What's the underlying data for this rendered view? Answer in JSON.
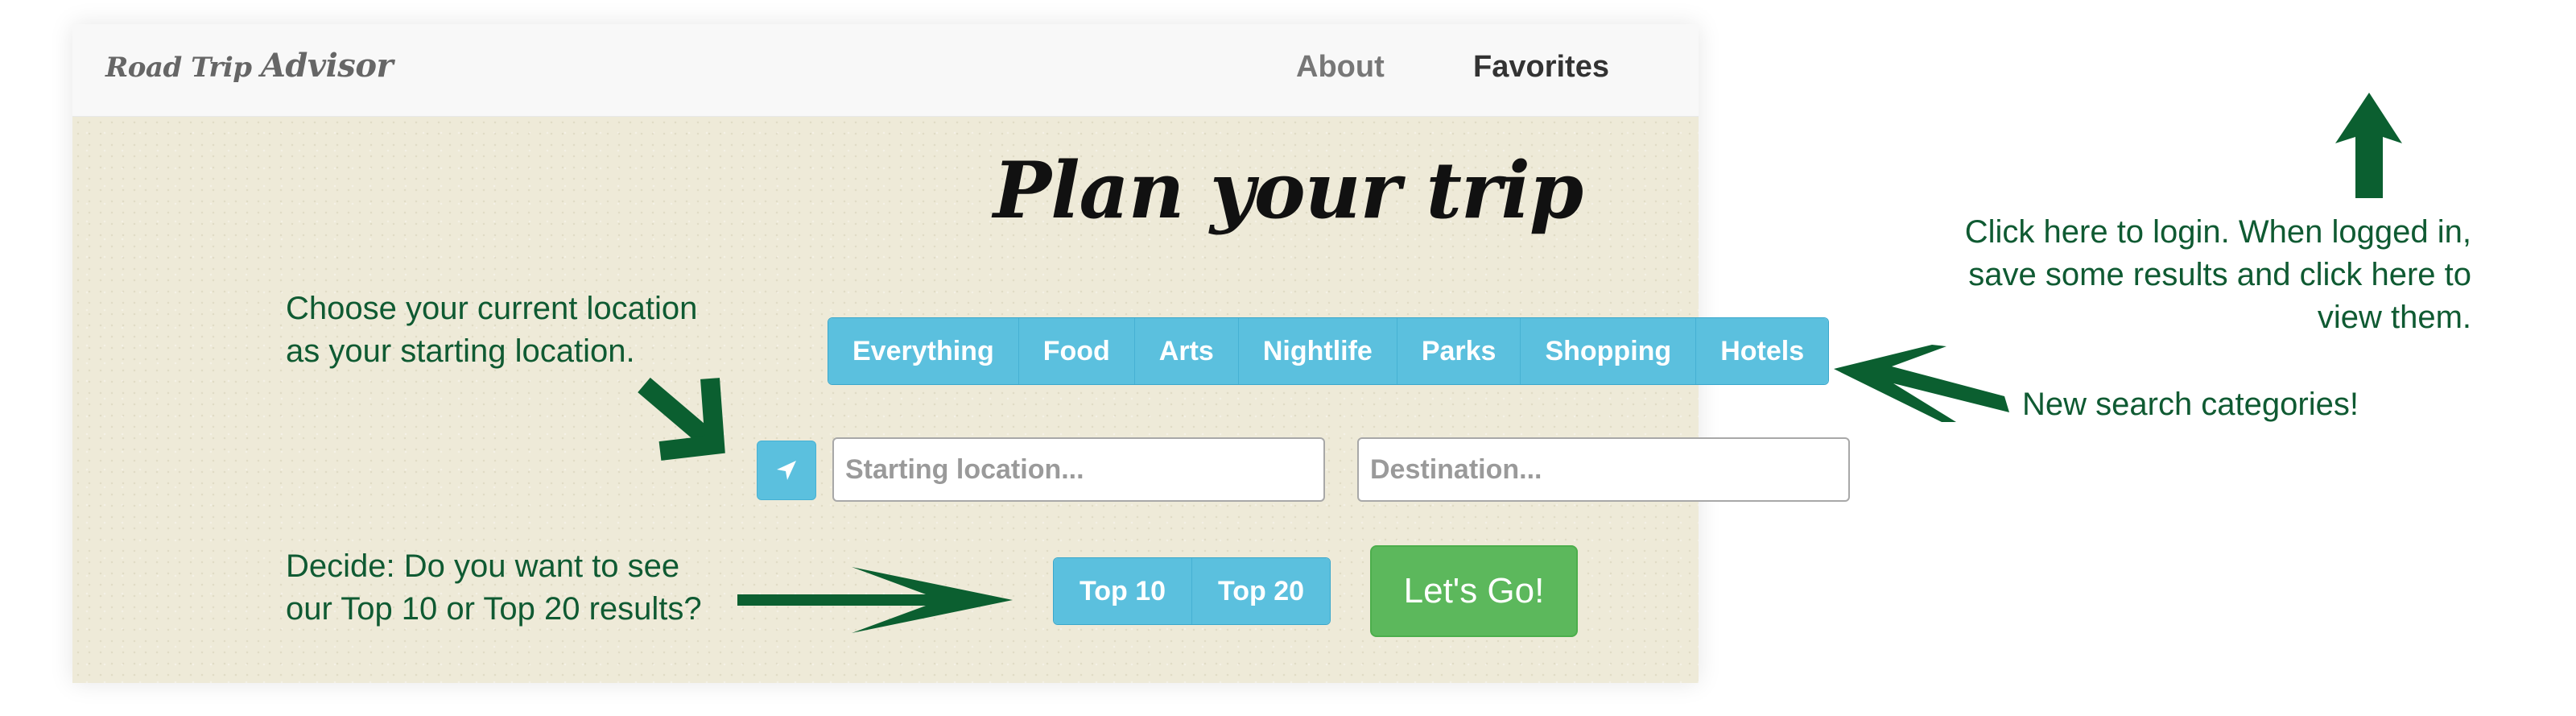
{
  "navbar": {
    "brand_part1": "Road Trip",
    "brand_part2": "Advisor",
    "about_label": "About",
    "favorites_label": "Favorites"
  },
  "hero": {
    "title": "Plan your trip"
  },
  "categories": [
    "Everything",
    "Food",
    "Arts",
    "Nightlife",
    "Parks",
    "Shopping",
    "Hotels"
  ],
  "search": {
    "start_placeholder": "Starting location...",
    "destination_placeholder": "Destination..."
  },
  "results": {
    "top10_label": "Top 10",
    "top20_label": "Top 20",
    "go_label": "Let's Go!"
  },
  "annotations": {
    "current_location": [
      "Choose your current location",
      "as your starting location."
    ],
    "decide": [
      "Decide: Do you want to see",
      "our Top 10 or Top 20 results?"
    ],
    "login": [
      "Click here to login. When logged in,",
      "save some results and click here to",
      "view them."
    ],
    "categories_new": "New search categories!"
  },
  "icons": {
    "location": "location-arrow-icon",
    "annotation_arrow": "annotation-arrow-icon"
  },
  "colors": {
    "accent_blue": "#5bc0de",
    "go_green": "#5cb85c",
    "annotation_green": "#0f5a32",
    "hero_bg": "#eeead8"
  }
}
